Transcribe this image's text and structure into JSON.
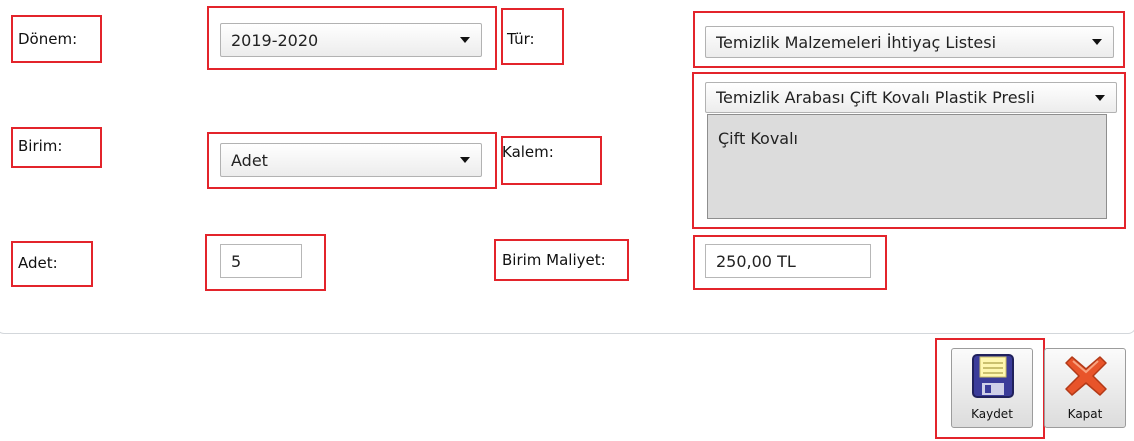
{
  "form": {
    "donem": {
      "label": "Dönem:",
      "value": "2019-2020"
    },
    "tur": {
      "label": "Tür:",
      "value": "Temizlik Malzemeleri İhtiyaç Listesi"
    },
    "birim": {
      "label": "Birim:",
      "value": "Adet"
    },
    "kalem": {
      "label": "Kalem:",
      "value": "Temizlik Arabası Çift Kovalı Plastik Presli",
      "description": "Çift Kovalı"
    },
    "adet": {
      "label": "Adet:",
      "value": "5"
    },
    "birim_maliyet": {
      "label": "Birim Maliyet:",
      "value": "250,00 TL"
    }
  },
  "actions": {
    "save_label": "Kaydet",
    "close_label": "Kapat"
  },
  "colors": {
    "highlight": "#e3242b",
    "save_icon": "#3b3c9a",
    "close_icon": "#e8542a"
  }
}
